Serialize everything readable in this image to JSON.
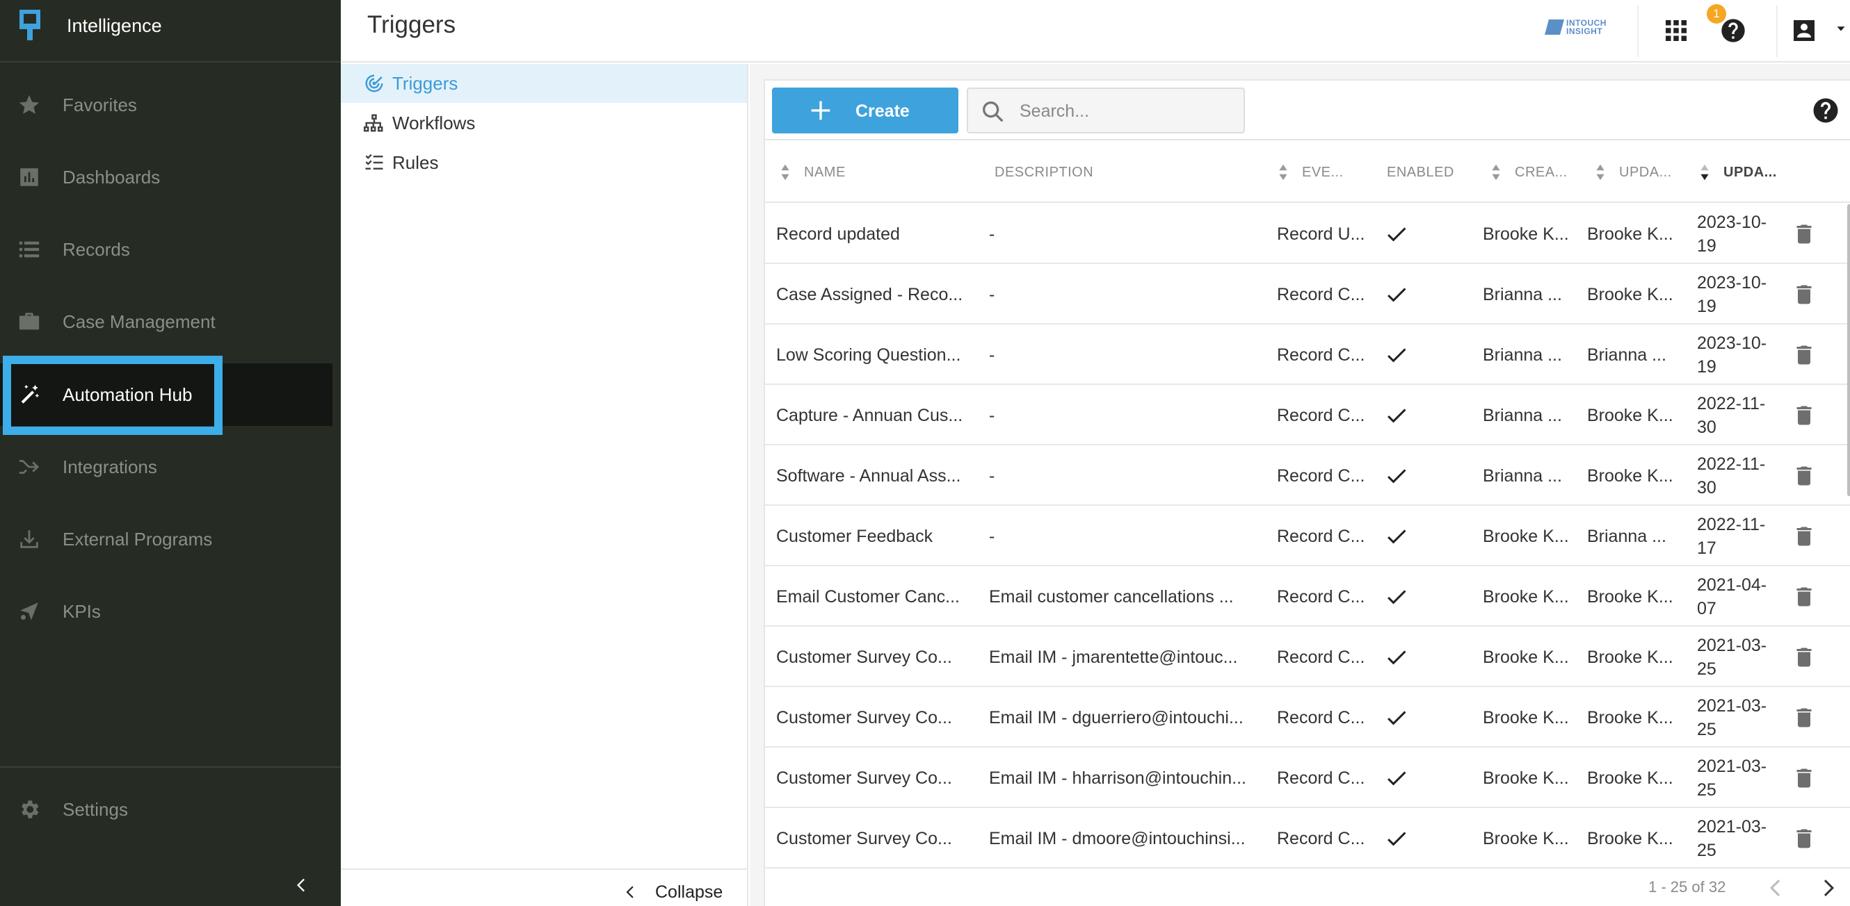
{
  "app": {
    "name": "Intelligence"
  },
  "sidebar": {
    "items": [
      {
        "label": "Favorites",
        "icon": "star-icon"
      },
      {
        "label": "Dashboards",
        "icon": "chart-icon"
      },
      {
        "label": "Records",
        "icon": "list-icon"
      },
      {
        "label": "Case Management",
        "icon": "briefcase-icon"
      },
      {
        "label": "Automation Hub",
        "icon": "magic-wand-icon",
        "active": true
      },
      {
        "label": "Integrations",
        "icon": "merge-arrow-icon"
      },
      {
        "label": "External Programs",
        "icon": "download-icon"
      },
      {
        "label": "KPIs",
        "icon": "kpi-icon"
      }
    ],
    "settings_label": "Settings"
  },
  "header": {
    "title": "Triggers",
    "logo_text_line1": "INTOUCH",
    "logo_text_line2": "INSIGHT",
    "notification_count": "1"
  },
  "subnav": {
    "items": [
      {
        "label": "Triggers",
        "active": true
      },
      {
        "label": "Workflows"
      },
      {
        "label": "Rules"
      }
    ],
    "collapse_label": "Collapse"
  },
  "toolbar": {
    "create_label": "Create",
    "search_placeholder": "Search..."
  },
  "table": {
    "columns": {
      "name": "NAME",
      "description": "DESCRIPTION",
      "event": "EVE...",
      "enabled": "ENABLED",
      "created_by": "CREA...",
      "updated_by": "UPDA...",
      "updated": "UPDA..."
    },
    "rows": [
      {
        "name": "Record updated",
        "description": "-",
        "event": "Record U...",
        "enabled": true,
        "created_by": "Brooke K...",
        "updated_by": "Brooke K...",
        "updated": "2023-10-19"
      },
      {
        "name": "Case Assigned - Reco...",
        "description": "-",
        "event": "Record C...",
        "enabled": true,
        "created_by": "Brianna ...",
        "updated_by": "Brooke K...",
        "updated": "2023-10-19"
      },
      {
        "name": "Low Scoring Question...",
        "description": "-",
        "event": "Record C...",
        "enabled": true,
        "created_by": "Brianna ...",
        "updated_by": "Brianna ...",
        "updated": "2023-10-19"
      },
      {
        "name": "Capture - Annuan Cus...",
        "description": "-",
        "event": "Record C...",
        "enabled": true,
        "created_by": "Brianna ...",
        "updated_by": "Brooke K...",
        "updated": "2022-11-30"
      },
      {
        "name": "Software - Annual Ass...",
        "description": "-",
        "event": "Record C...",
        "enabled": true,
        "created_by": "Brianna ...",
        "updated_by": "Brooke K...",
        "updated": "2022-11-30"
      },
      {
        "name": "Customer Feedback",
        "description": "-",
        "event": "Record C...",
        "enabled": true,
        "created_by": "Brooke K...",
        "updated_by": "Brianna ...",
        "updated": "2022-11-17"
      },
      {
        "name": "Email Customer Canc...",
        "description": "Email customer cancellations ...",
        "event": "Record C...",
        "enabled": true,
        "created_by": "Brooke K...",
        "updated_by": "Brooke K...",
        "updated": "2021-04-07"
      },
      {
        "name": "Customer Survey Co...",
        "description": "Email IM - jmarentette@intouc...",
        "event": "Record C...",
        "enabled": true,
        "created_by": "Brooke K...",
        "updated_by": "Brooke K...",
        "updated": "2021-03-25"
      },
      {
        "name": "Customer Survey Co...",
        "description": "Email IM - dguerriero@intouchi...",
        "event": "Record C...",
        "enabled": true,
        "created_by": "Brooke K...",
        "updated_by": "Brooke K...",
        "updated": "2021-03-25"
      },
      {
        "name": "Customer Survey Co...",
        "description": "Email IM - hharrison@intouchin...",
        "event": "Record C...",
        "enabled": true,
        "created_by": "Brooke K...",
        "updated_by": "Brooke K...",
        "updated": "2021-03-25"
      },
      {
        "name": "Customer Survey Co...",
        "description": "Email IM - dmoore@intouchinsi...",
        "event": "Record C...",
        "enabled": true,
        "created_by": "Brooke K...",
        "updated_by": "Brooke K...",
        "updated": "2021-03-25"
      }
    ],
    "pagination": "1 - 25 of 32"
  },
  "colors": {
    "sidebar_bg": "#262b24",
    "accent": "#3ea2dd",
    "highlight_box": "#3daee9",
    "badge": "#f5a623"
  }
}
